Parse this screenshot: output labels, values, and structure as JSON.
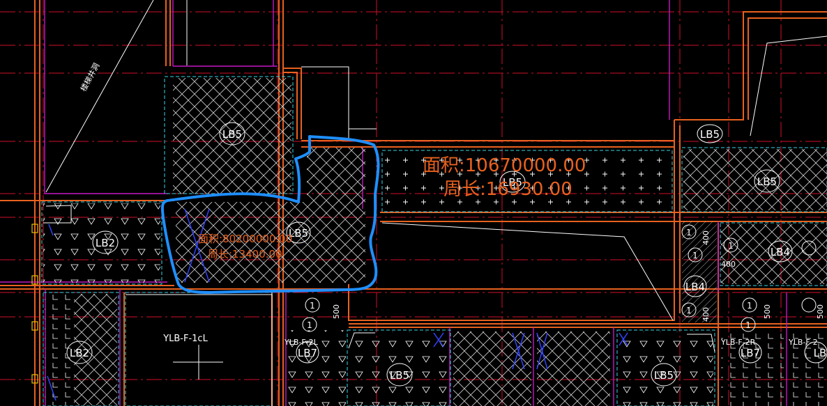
{
  "colors": {
    "background": "#000000",
    "axis_line": "#d0102a",
    "wall": "#e8611f",
    "slab_edge": "#33d6e6",
    "beam": "#c418c4",
    "hatch": "#d8d8d8",
    "label": "#ffffff",
    "area_text": "#e8611f",
    "markup": "#1f8fff",
    "rebar": "#3344ff",
    "marker": "#e8c000"
  },
  "labels": {
    "lb5_top": "LB5",
    "lb5_sel": "LB5",
    "lb5_mid": "LB5",
    "lb5_right_top": "LB5",
    "lb5_right": "LB5",
    "lb2_left": "LB2",
    "lb2_lower": "LB2",
    "lb4_right": "LB4",
    "lb4_col": "LB4",
    "lb7_a": "LB7",
    "lb7_b": "LB7",
    "lb5_bot_a": "LB5",
    "lb5_bot_b": "LB5",
    "lb_partial": "LB",
    "ylb_main": "YLB-F-1cL",
    "ylb_small_a": "YLB-F-2L",
    "ylb_small_b": "YLB-F-2R",
    "ylb_small_c": "YLB-F-2",
    "stair_text": "楼梯井洞"
  },
  "measurements": {
    "sel_area": "面积:80200000.00",
    "sel_perim": "周长:13400.00",
    "mid_area": "面积:10670000.00",
    "mid_perim": "周长:16930.00"
  },
  "rebar_marks": {
    "m1": "1",
    "m2": "1",
    "m3": "1",
    "m4": "1",
    "m5": "1",
    "m6": "1",
    "m7": "1",
    "m8": "1",
    "d400_a": "400",
    "d400_b": "400",
    "d400_c": "400",
    "d500_a": "500",
    "d500_b": "500",
    "d500_c": "500"
  }
}
